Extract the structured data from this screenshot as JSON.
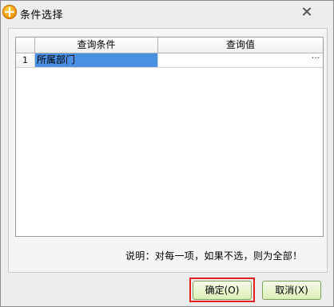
{
  "window": {
    "title": "条件选择",
    "close_icon": "close-icon",
    "app_icon": "app-logo-icon"
  },
  "grid": {
    "columns": [
      "查询条件",
      "查询值"
    ],
    "rows": [
      {
        "number": "1",
        "field": "所属部门",
        "value": ""
      }
    ],
    "ellipsis": "···"
  },
  "note": "说明：对每一项，如果不选，则为全部！",
  "buttons": {
    "ok": "确定(O)",
    "cancel": "取消(X)"
  },
  "colors": {
    "selection": "#4a90e2",
    "button_fill": "#dcefb8",
    "focus_frame": "#e02020"
  }
}
